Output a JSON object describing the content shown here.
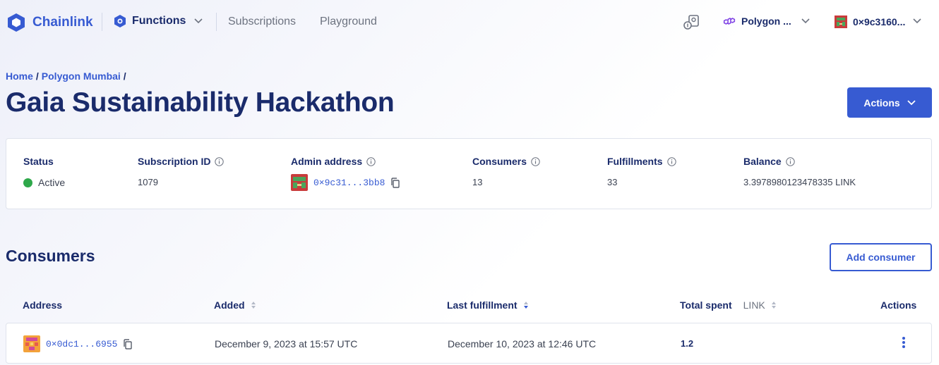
{
  "nav": {
    "brand": "Chainlink",
    "product": "Functions",
    "links": [
      "Subscriptions",
      "Playground"
    ],
    "network": "Polygon ...",
    "wallet": "0×9c3160..."
  },
  "breadcrumb": {
    "home": "Home",
    "network": "Polygon Mumbai",
    "sep": "/"
  },
  "page": {
    "title": "Gaia Sustainability Hackathon",
    "actions_label": "Actions"
  },
  "summary": {
    "status": {
      "label": "Status",
      "value": "Active"
    },
    "subscription_id": {
      "label": "Subscription ID",
      "value": "1079"
    },
    "admin": {
      "label": "Admin address",
      "value": "0×9c31...3bb8"
    },
    "consumers": {
      "label": "Consumers",
      "value": "13"
    },
    "fulfillments": {
      "label": "Fulfillments",
      "value": "33"
    },
    "balance": {
      "label": "Balance",
      "value": "3.3978980123478335 LINK"
    }
  },
  "consumers": {
    "title": "Consumers",
    "add_label": "Add consumer",
    "columns": {
      "address": "Address",
      "added": "Added",
      "last_fulfillment": "Last fulfillment",
      "total_spent": "Total spent",
      "total_spent_unit": "LINK",
      "actions": "Actions"
    },
    "rows": [
      {
        "address": "0×0dc1...6955",
        "added": "December 9, 2023 at 15:57 UTC",
        "last_fulfillment": "December 10, 2023 at 12:46 UTC",
        "total_spent": "1.2"
      }
    ]
  },
  "colors": {
    "brand_blue": "#375bd2",
    "navy": "#1a2b6b",
    "status_active": "#2ea84a"
  }
}
